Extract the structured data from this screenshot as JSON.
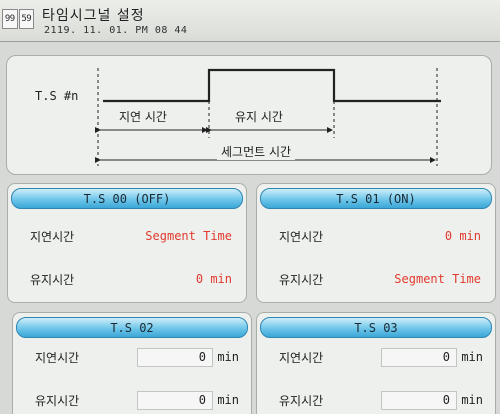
{
  "header": {
    "counter": [
      "99",
      "59"
    ],
    "title": "타임시그널 설정",
    "datetime": "2119. 11. 01. PM 08 44"
  },
  "diagram": {
    "signal_label": "T.S #n",
    "delay_label": "지연 시간",
    "hold_label": "유지 시간",
    "segment_label": "세그먼트 시간"
  },
  "panels": [
    {
      "title": "T.S 00 (OFF)",
      "rows": [
        {
          "label": "지연시간",
          "value": "Segment Time"
        },
        {
          "label": "유지시간",
          "value": "0 min"
        }
      ]
    },
    {
      "title": "T.S 01 (ON)",
      "rows": [
        {
          "label": "지연시간",
          "value": "0 min"
        },
        {
          "label": "유지시간",
          "value": "Segment Time"
        }
      ]
    },
    {
      "title": "T.S 02",
      "rows": [
        {
          "label": "지연시간",
          "value": "0",
          "unit": "min"
        },
        {
          "label": "유지시간",
          "value": "0",
          "unit": "min"
        }
      ]
    },
    {
      "title": "T.S 03",
      "rows": [
        {
          "label": "지연시간",
          "value": "0",
          "unit": "min"
        },
        {
          "label": "유지시간",
          "value": "0",
          "unit": "min"
        }
      ]
    }
  ],
  "colors": {
    "highlight_value": "#e23a2e",
    "panel_header": "#6fc6ea"
  }
}
